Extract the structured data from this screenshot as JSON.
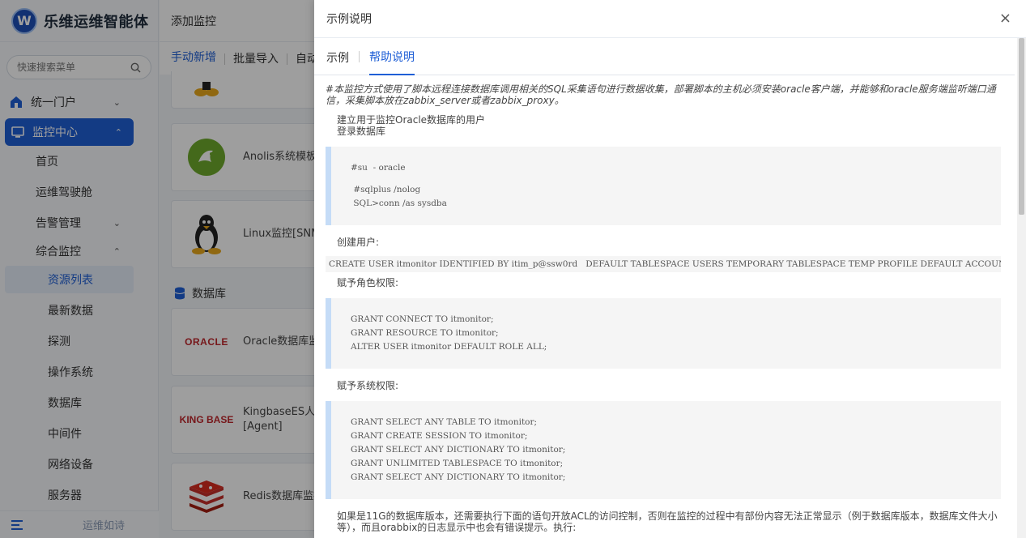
{
  "brand": {
    "logo": "W",
    "title": "乐维运维智能体"
  },
  "sidebar": {
    "search_placeholder": "快速搜索菜单",
    "menu": {
      "portal": "统一门户",
      "monitor_center": "监控中心",
      "home": "首页",
      "cockpit": "运维驾驶舱",
      "alarm": "告警管理",
      "integrated": "综合监控",
      "resource_list": "资源列表",
      "latest_data": "最新数据",
      "probe": "探测",
      "os": "操作系统",
      "database": "数据库",
      "middleware": "中间件",
      "network": "网络设备",
      "server": "服务器"
    },
    "footer_motto": "运维如诗"
  },
  "main": {
    "header_title": "添加监控",
    "tabs": [
      "手动新增",
      "批量导入",
      "自动"
    ],
    "cards": {
      "anolis": "Anolis系统模板",
      "linux": "Linux监控[SNMP",
      "section_db": "数据库",
      "oracle_logo": "ORACLE",
      "oracle": "Oracle数据库监控",
      "kingbase_logo": "KING BASE",
      "kingbase_l1": "KingbaseES人大",
      "kingbase_l2": "[Agent]",
      "redis": "Redis数据库监控"
    }
  },
  "drawer": {
    "title": "示例说明",
    "close": "×",
    "tabs": [
      "示例",
      "帮助说明"
    ],
    "note": "#本监控方式使用了脚本远程连接数据库调用相关的SQL采集语句进行数据收集，部署脚本的主机必须安装oracle客户端，并能够和oracle服务端监听端口通信，采集脚本放在zabbix_server或者zabbix_proxy。",
    "p1a": "建立用于监控Oracle数据库的用户",
    "p1b": "登录数据库",
    "code1": [
      "#su  - oracle",
      "",
      " #sqlplus /nolog",
      " SQL>conn /as sysdba"
    ],
    "p2": "创建用户:",
    "code_create": "CREATE USER itmonitor IDENTIFIED BY itim_p@ssw0rd   DEFAULT TABLESPACE USERS TEMPORARY TABLESPACE TEMP PROFILE DEFAULT ACCOUNT UNLOCK;",
    "p3": "赋予角色权限:",
    "code2": [
      "GRANT CONNECT TO itmonitor;",
      "GRANT RESOURCE TO itmonitor;",
      "ALTER USER itmonitor DEFAULT ROLE ALL;"
    ],
    "p4": "赋予系统权限:",
    "code3": [
      "GRANT SELECT ANY TABLE TO itmonitor;",
      "GRANT CREATE SESSION TO itmonitor;",
      "GRANT SELECT ANY DICTIONARY TO itmonitor;",
      "GRANT UNLIMITED TABLESPACE TO itmonitor;",
      "GRANT SELECT ANY DICTIONARY TO itmonitor;"
    ],
    "p5": "如果是11G的数据库版本，还需要执行下面的语句开放ACL的访问控制，否则在监控的过程中有部份内容无法正常显示（例于数据库版本，数据库文件大小等），而且orabbix的日志显示中也会有错误提示。执行:"
  },
  "colors": {
    "accent": "#1f5fd6",
    "code_border": "#c5dcf7"
  }
}
